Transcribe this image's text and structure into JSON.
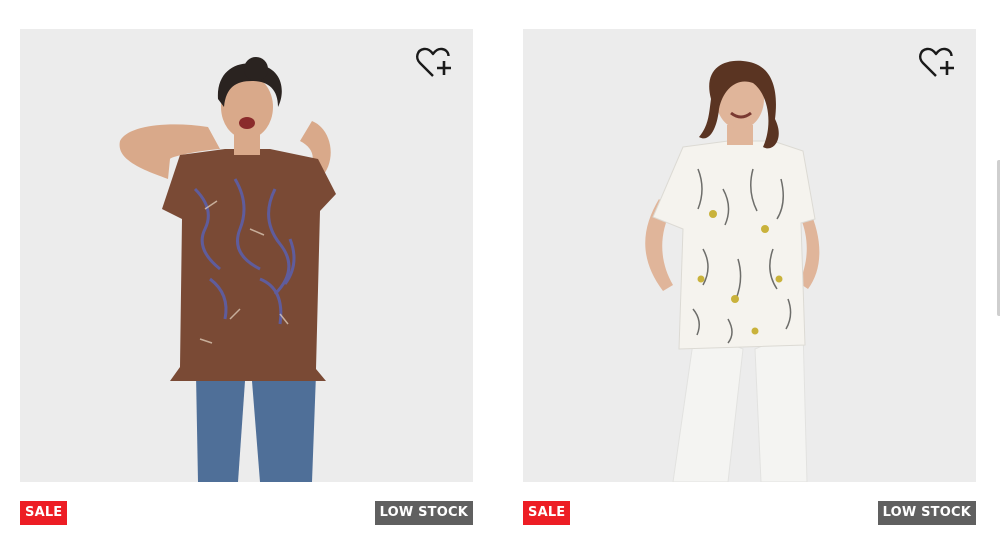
{
  "products": [
    {
      "badges": {
        "sale": "SALE",
        "stock": "LOW STOCK"
      },
      "wishlist_icon": "heart-plus-icon",
      "colors": {
        "shirt": "#7a4a35",
        "pattern": "#5d5fa8",
        "pants": "#4f6f98",
        "skin": "#d9a98a",
        "hair": "#2a2320"
      }
    },
    {
      "badges": {
        "sale": "SALE",
        "stock": "LOW STOCK"
      },
      "wishlist_icon": "heart-plus-icon",
      "colors": {
        "shirt": "#f5f3ee",
        "pattern": "#c9b23b",
        "pants": "#f4f4f2",
        "skin": "#e0b59a",
        "hair": "#5a3422"
      }
    }
  ],
  "theme": {
    "sale_badge_bg": "#ed1d24",
    "stock_badge_bg": "#606060",
    "photo_bg": "#ececec"
  }
}
